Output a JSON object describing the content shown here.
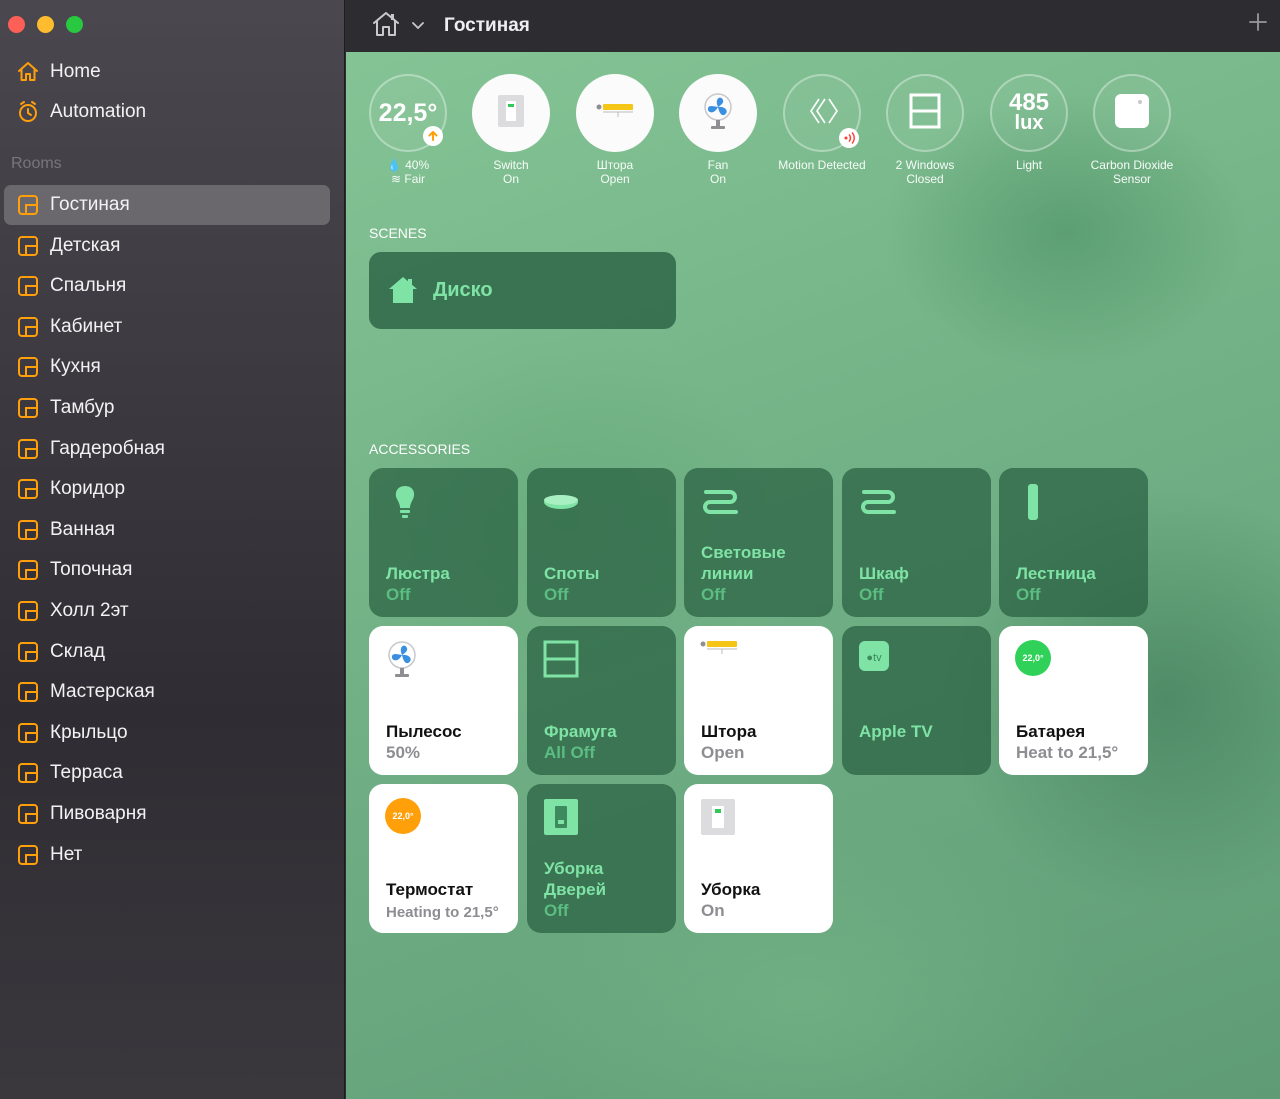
{
  "window": {
    "title": "Гостиная",
    "colors": {
      "accent": "#ff9f0a",
      "tile_off_text": "#7fe3a5",
      "heat_green": "#30d158",
      "heat_orange": "#ff9f0a"
    }
  },
  "sidebar": {
    "nav": [
      {
        "label": "Home",
        "icon": "house-icon"
      },
      {
        "label": "Automation",
        "icon": "clock-icon"
      }
    ],
    "rooms_header": "Rooms",
    "rooms": [
      {
        "label": "Гостиная",
        "selected": true
      },
      {
        "label": "Детская"
      },
      {
        "label": "Спальня"
      },
      {
        "label": "Кабинет"
      },
      {
        "label": "Кухня"
      },
      {
        "label": "Тамбур"
      },
      {
        "label": "Гардеробная"
      },
      {
        "label": "Коридор"
      },
      {
        "label": "Ванная"
      },
      {
        "label": "Топочная"
      },
      {
        "label": "Холл 2эт"
      },
      {
        "label": "Склад"
      },
      {
        "label": "Мастерская"
      },
      {
        "label": "Крыльцо"
      },
      {
        "label": "Терраса"
      },
      {
        "label": "Пивоварня"
      },
      {
        "label": "Нет"
      }
    ]
  },
  "status": {
    "climate": {
      "temp": "22,5°",
      "humidity": "40%",
      "air": "Fair"
    },
    "switch": {
      "name": "Switch",
      "state": "On"
    },
    "curtain": {
      "name": "Штора",
      "state": "Open"
    },
    "fan": {
      "name": "Fan",
      "state": "On"
    },
    "motion": {
      "name": "Motion Detected"
    },
    "windows": {
      "name": "2 Windows",
      "state": "Closed"
    },
    "light": {
      "value": "485",
      "unit": "lux",
      "name": "Light"
    },
    "co2": {
      "name": "Carbon Dioxide",
      "state": "Sensor"
    }
  },
  "scenes": {
    "header": "SCENES",
    "items": [
      {
        "label": "Диско"
      }
    ]
  },
  "accessories": {
    "header": "ACCESSORIES",
    "tiles": [
      {
        "name": "Люстра",
        "state": "Off"
      },
      {
        "name": "Споты",
        "state": "Off"
      },
      {
        "name": "Световые линии",
        "state": "Off"
      },
      {
        "name": "Шкаф",
        "state": "Off"
      },
      {
        "name": "Лестница",
        "state": "Off"
      },
      {
        "name": "Пылесос",
        "state": "50%"
      },
      {
        "name": "Фрамуга",
        "state": "All Off"
      },
      {
        "name": "Штора",
        "state": "Open"
      },
      {
        "name": "Apple TV",
        "state": ""
      },
      {
        "name": "Батарея",
        "state": "Heat to 21,5°",
        "badge": "22,0°"
      },
      {
        "name": "Термостат",
        "state": "Heating to 21,5°",
        "badge": "22,0°"
      },
      {
        "name": "Уборка Дверей",
        "state": "Off"
      },
      {
        "name": "Уборка",
        "state": "On"
      }
    ]
  }
}
